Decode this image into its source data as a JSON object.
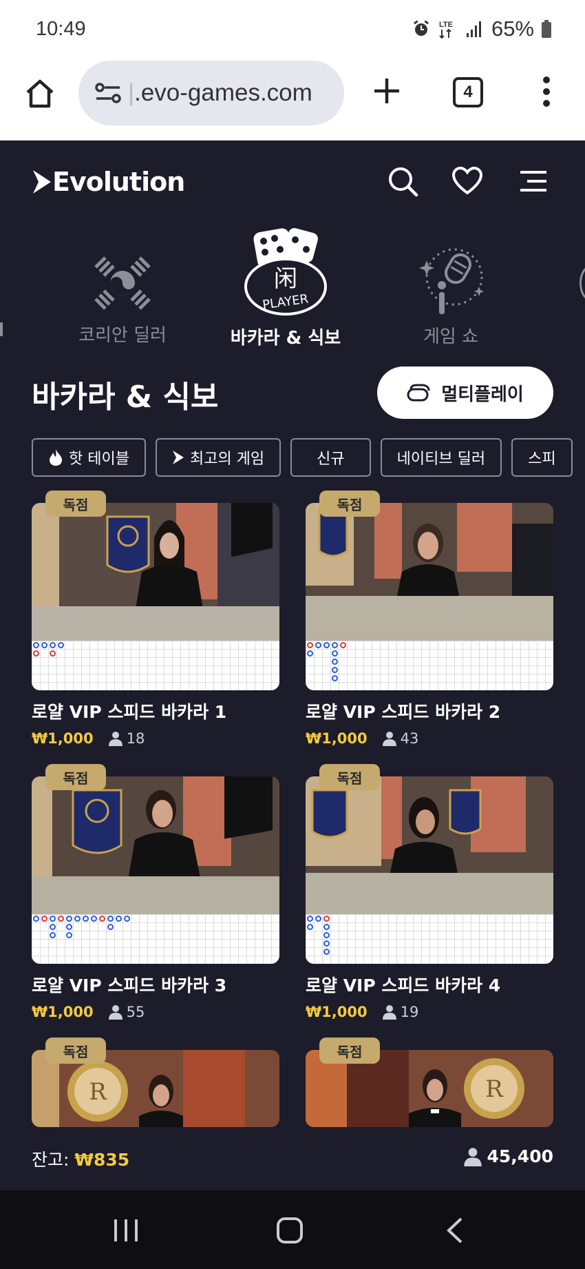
{
  "status_bar": {
    "time": "10:49",
    "battery": "65%",
    "network": "LTE"
  },
  "browser": {
    "url_faint": "|",
    "url": ".evo-games.com",
    "tab_count": "4"
  },
  "header": {
    "logo": "Evolution"
  },
  "categories": [
    {
      "label": "코리안 딜러",
      "icon": "korean-flag-icon",
      "active": false
    },
    {
      "label": "바카라 & 식보",
      "icon": "baccarat-dice-icon",
      "active": true
    },
    {
      "label": "게임 쇼",
      "icon": "microphone-icon",
      "active": false
    }
  ],
  "category_badge_text": "闲",
  "category_badge_sub": "PLAYER",
  "section": {
    "title": "바카라 & 식보",
    "multiplay_label": "멀티플레이"
  },
  "filters": [
    {
      "label": "핫 테이블",
      "icon": "flame-icon"
    },
    {
      "label": "최고의 게임",
      "icon": "evolution-mark-icon"
    },
    {
      "label": "신규",
      "icon": ""
    },
    {
      "label": "네이티브 딜러",
      "icon": ""
    },
    {
      "label": "스피",
      "icon": ""
    }
  ],
  "games": [
    {
      "badge": "독점",
      "title": "로얄 VIP 스피드 바카라 1",
      "min_bet": "₩1,000",
      "players": "18"
    },
    {
      "badge": "독점",
      "title": "로얄 VIP 스피드 바카라 2",
      "min_bet": "₩1,000",
      "players": "43"
    },
    {
      "badge": "독점",
      "title": "로얄 VIP 스피드 바카라 3",
      "min_bet": "₩1,000",
      "players": "55"
    },
    {
      "badge": "독점",
      "title": "로얄 VIP 스피드 바카라 4",
      "min_bet": "₩1,000",
      "players": "19"
    },
    {
      "badge": "독점",
      "title": "",
      "min_bet": "",
      "players": ""
    },
    {
      "badge": "독점",
      "title": "",
      "min_bet": "",
      "players": ""
    }
  ],
  "footer": {
    "balance_label": "잔고:",
    "balance_amount": "₩835",
    "online_count": "45,400"
  },
  "colors": {
    "background": "#1c1c2a",
    "gold": "#c6a96d",
    "price": "#f3cb41"
  }
}
